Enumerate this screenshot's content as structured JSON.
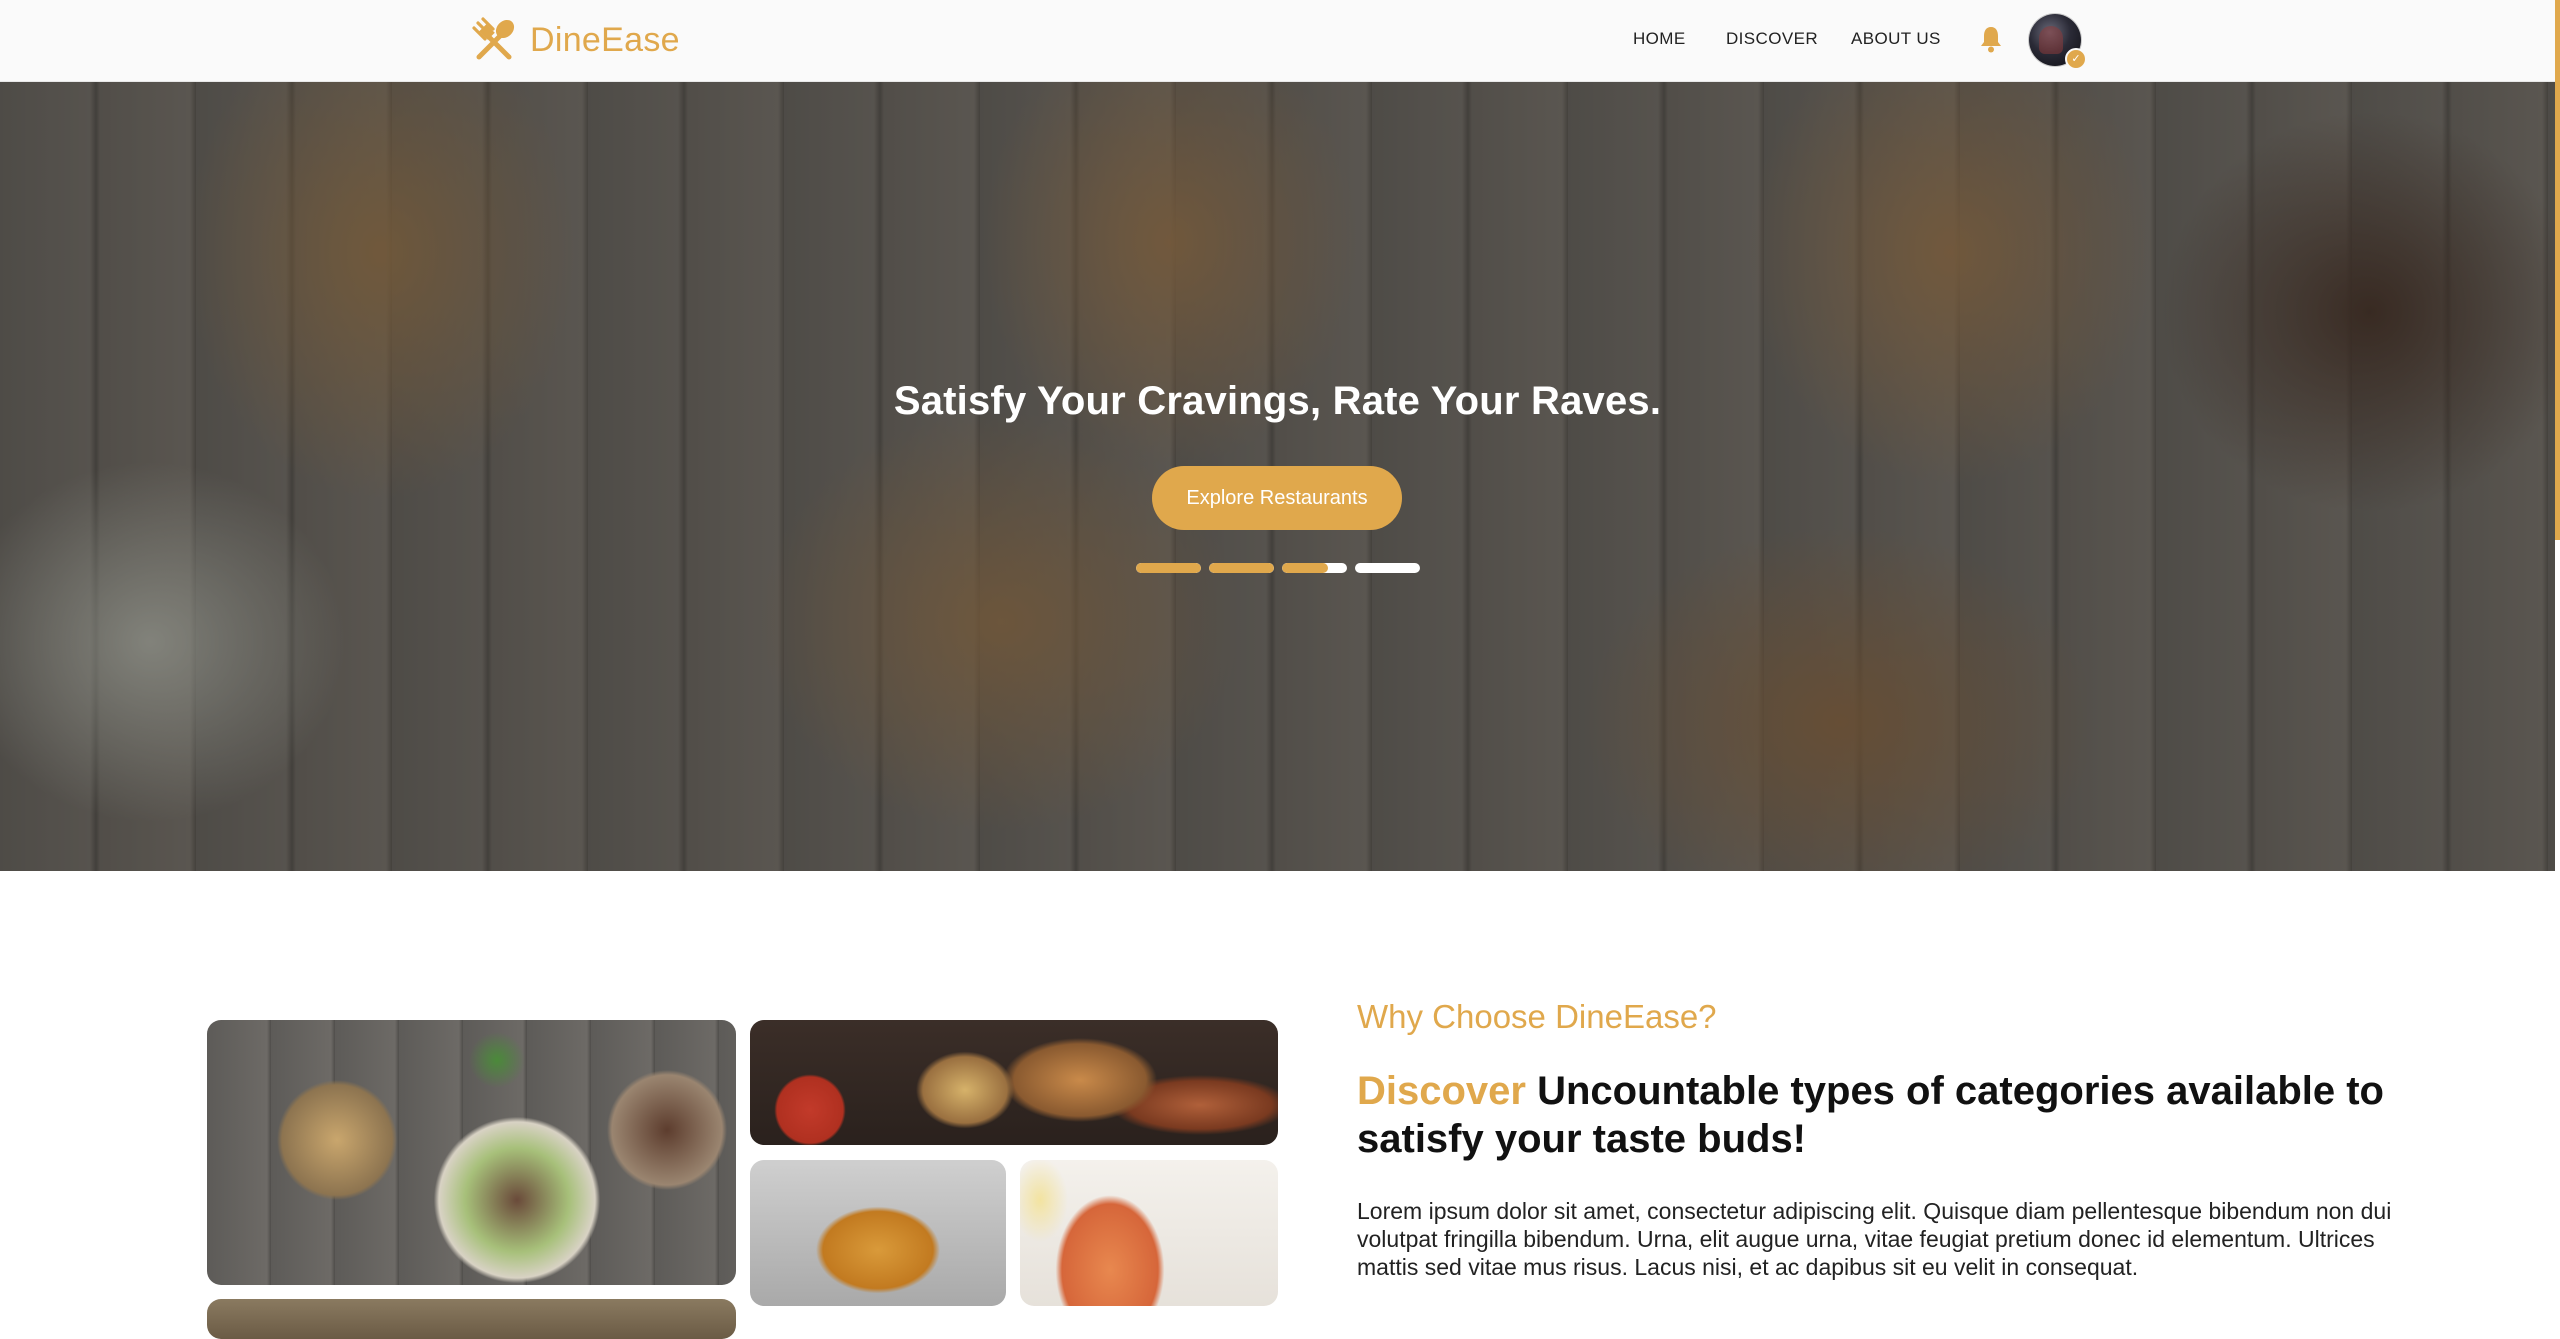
{
  "brand": {
    "name": "DineEase",
    "icon": "spoon-fork-icon",
    "accent_color": "#e0a84c"
  },
  "nav": {
    "links": [
      {
        "label": "HOME"
      },
      {
        "label": "DISCOVER"
      },
      {
        "label": "ABOUT US"
      }
    ],
    "notification_icon": "bell-icon",
    "avatar_badge_icon": "check-icon"
  },
  "hero": {
    "title": "Satisfy Your Cravings, Rate Your Raves.",
    "cta_label": "Explore Restaurants",
    "slides": [
      {
        "progress": 1.0
      },
      {
        "progress": 1.0
      },
      {
        "progress": 0.7
      },
      {
        "progress": 0.0
      }
    ]
  },
  "about": {
    "eyebrow": "Why Choose DineEase?",
    "heading_accent": "Discover",
    "heading_rest": " Uncountable types of categories available to satisfy your taste buds!",
    "body": "Lorem ipsum dolor sit amet, consectetur adipiscing elit. Quisque diam pellentesque bibendum non dui volutpat fringilla bibendum. Urna, elit augue urna, vitae feugiat pretium donec id elementum. Ultrices mattis sed vitae mus risus. Lacus nisi, et ac dapibus sit eu velit in consequat."
  }
}
